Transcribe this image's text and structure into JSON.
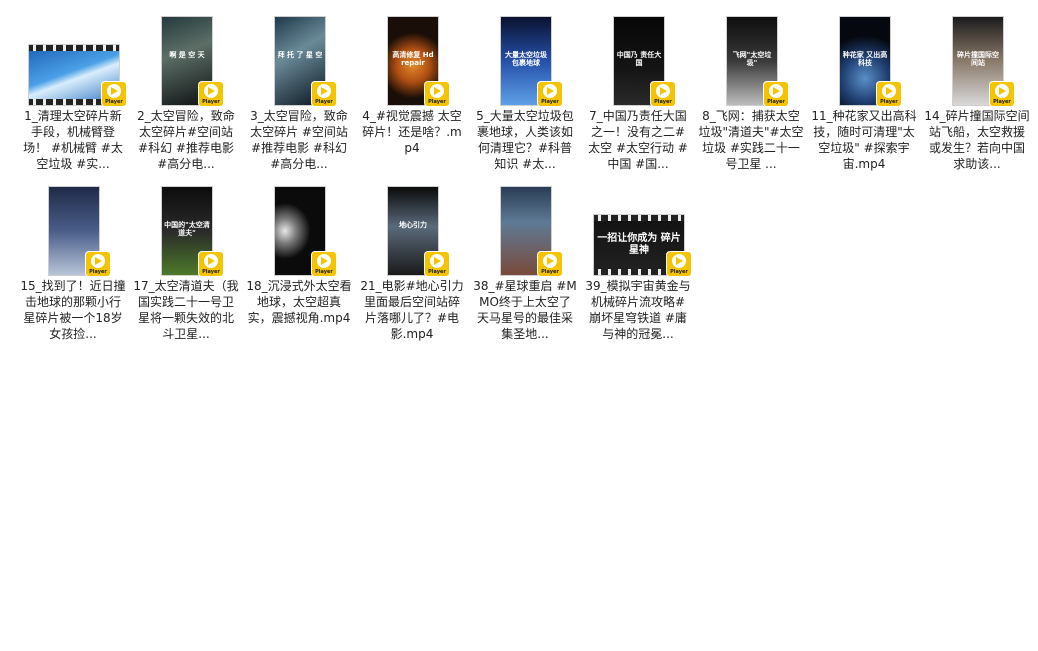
{
  "colors": {
    "badge": "#f5c400",
    "background": "#ffffff",
    "text": "#222222"
  },
  "badge_icon": "play-icon",
  "files": [
    {
      "name": "1_清理太空碎片新手段，机械臂登场！ #机械臂 #太空垃圾 #实...",
      "thumb_text": "",
      "badge": "Player",
      "kind": "landscape-film",
      "bg": "linear-gradient(160deg,#1c5fb5 0%,#4aa0e6 45%,#d9eefc 55%,#2a6fc0 100%)"
    },
    {
      "name": "2_太空冒险，致命太空碎片#空间站 #科幻 #推荐电影 #高分电...",
      "thumb_text": "啊 是 空 天",
      "badge": "Player",
      "kind": "portrait",
      "bg": "linear-gradient(160deg,#243a3d 0%,#5c6e66 40%,#0d1112 100%)"
    },
    {
      "name": "3_太空冒险，致命太空碎片 #空间站 #推荐电影 #科幻 #高分电...",
      "thumb_text": "拜 托 了 星 空",
      "badge": "Player",
      "kind": "portrait",
      "bg": "linear-gradient(150deg,#1f3a4a 0%,#6a8a98 40%,#0b1620 100%)"
    },
    {
      "name": "4_#视觉震撼 太空碎片！还是啥？.mp4",
      "thumb_text": "高清修复 Hd repair",
      "badge": "Player",
      "kind": "portrait",
      "bg": "radial-gradient(circle at 50% 55%,#e08a2c 0%,#b04f12 30%,#1a0f08 60%)"
    },
    {
      "name": "5_大量太空垃圾包裹地球，人类该如何清理它？#科普知识 #太...",
      "thumb_text": "大量太空垃圾 包裹地球",
      "badge": "Player",
      "kind": "portrait",
      "bg": "linear-gradient(180deg,#0a1230 0%,#2550a8 50%,#5fa0e8 100%)"
    },
    {
      "name": "7_中国乃责任大国之一！没有之二#太空 #太空行动 #中国 #国...",
      "thumb_text": "中国乃 责任大国",
      "badge": "Player",
      "kind": "portrait",
      "bg": "linear-gradient(180deg,#070707 0%,#151515 60%,#2a2a2a 100%)"
    },
    {
      "name": "8_飞网：捕获太空垃圾\"清道夫\"#太空垃圾 #实践二十一号卫星 ...",
      "thumb_text": "飞网\"太空垃圾\"",
      "badge": "Player",
      "kind": "portrait",
      "bg": "linear-gradient(180deg,#0d0d0d 0%,#3a3a3a 50%,#bcbcbc 100%)"
    },
    {
      "name": "11_种花家又出高科技，随时可清理\"太空垃圾\" #探索宇宙.mp4",
      "thumb_text": "种花家 又出高科技",
      "badge": "Player",
      "kind": "portrait",
      "bg": "radial-gradient(circle at 50% 70%,#5a8fc8 0%,#1f3e70 35%,#05080f 65%)"
    },
    {
      "name": "14_碎片撞国际空间站飞船，太空救援或发生？若向中国求助该...",
      "thumb_text": "碎片撞国际空间站",
      "badge": "Player",
      "kind": "portrait",
      "bg": "linear-gradient(180deg,#1b1b1b 0%,#8a7a6a 50%,#d8d8d8 100%)"
    },
    {
      "name": "15_找到了！近日撞击地球的那颗小行星碎片被一个18岁女孩捡...",
      "thumb_text": "",
      "badge": "Player",
      "kind": "portrait",
      "bg": "linear-gradient(180deg,#1e2a48 0%,#4a5e8a 50%,#b8c4d8 100%)"
    },
    {
      "name": "17_太空清道夫（我国实践二十一号卫星将一颗失效的北斗卫星...",
      "thumb_text": "中国的\"太空清道夫\"",
      "badge": "Player",
      "kind": "portrait",
      "bg": "linear-gradient(180deg,#0c0c0c 0%,#2a2a2a 50%,#4d7a2a 100%)"
    },
    {
      "name": "18_沉浸式外太空看地球，太空超真实，震撼视角.mp4",
      "thumb_text": "",
      "badge": "Player",
      "kind": "portrait",
      "bg": "radial-gradient(ellipse at 20% 50%,#e8e8e8 0%,#7a7a7a 20%,#0b0b0b 45%)"
    },
    {
      "name": "21_电影#地心引力 里面最后空间站碎片落哪儿了？#电影.mp4",
      "thumb_text": "地心引力",
      "badge": "Player",
      "kind": "portrait",
      "bg": "linear-gradient(180deg,#0a0a0a 0%,#5a6a7a 45%,#1a1a1a 100%)"
    },
    {
      "name": "38_#星球重启 #MMO终于上太空了 天马星号的最佳采集圣地...",
      "thumb_text": "",
      "badge": "Player",
      "kind": "portrait",
      "bg": "linear-gradient(180deg,#2a3c55 0%,#5e7a95 40%,#7a4a3a 100%)"
    },
    {
      "name": "39_模拟宇宙黄金与机械碎片流攻略#崩坏星穹铁道 #庸与神的冠冕...",
      "thumb_text": "一招让你成为 碎片星神",
      "badge": "Player",
      "kind": "landscape-film",
      "bg": "linear-gradient(180deg,#111 0%,#222 100%)"
    }
  ]
}
